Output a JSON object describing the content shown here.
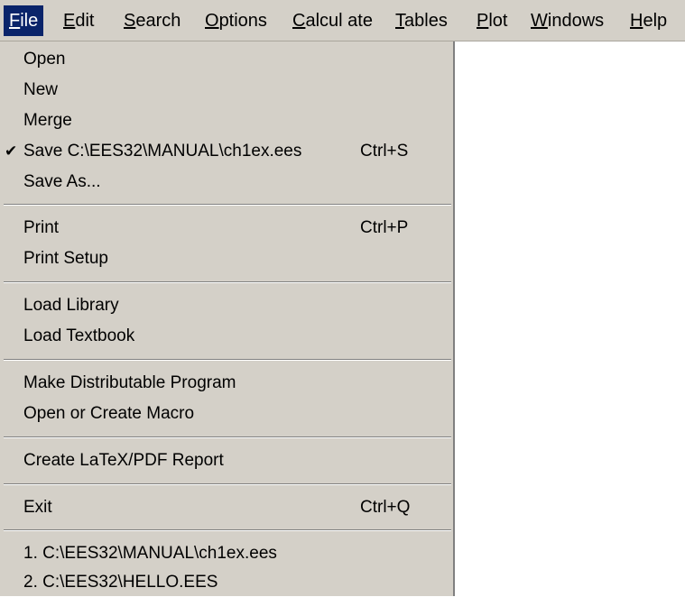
{
  "menubar": {
    "items": [
      {
        "label": "File",
        "mnemonic": "F",
        "rest": "ile"
      },
      {
        "label": "Edit",
        "mnemonic": "E",
        "rest": "dit"
      },
      {
        "label": "Search",
        "mnemonic": "S",
        "rest": "earch"
      },
      {
        "label": "Options",
        "mnemonic": "O",
        "rest": "ptions"
      },
      {
        "label": "Calculate",
        "mnemonic": "C",
        "rest": "alcul ate"
      },
      {
        "label": "Tables",
        "mnemonic": "T",
        "rest": "ables"
      },
      {
        "label": "Plot",
        "mnemonic": "P",
        "rest": "lot"
      },
      {
        "label": "Windows",
        "mnemonic": "W",
        "rest": "indows"
      },
      {
        "label": "Help",
        "mnemonic": "H",
        "rest": "elp"
      }
    ],
    "active_index": 0
  },
  "file_menu": {
    "open": "Open",
    "new": "New",
    "merge": "Merge",
    "save_check": "✔",
    "save": "Save C:\\EES32\\MANUAL\\ch1ex.ees",
    "save_shortcut": "Ctrl+S",
    "save_as": "Save As...",
    "print": "Print",
    "print_shortcut": "Ctrl+P",
    "print_setup": "Print Setup",
    "load_library": "Load Library",
    "load_textbook": "Load Textbook",
    "make_distributable": "Make Distributable Program",
    "open_create_macro": "Open or Create Macro",
    "create_report": "Create LaTeX/PDF Report",
    "exit": "Exit",
    "exit_shortcut": "Ctrl+Q",
    "recent_1": "1. C:\\EES32\\MANUAL\\ch1ex.ees",
    "recent_2": "2. C:\\EES32\\HELLO.EES"
  },
  "colors": {
    "menu_face": "#d4d0c8",
    "highlight": "#0a246a",
    "highlight_text": "#ffffff"
  }
}
